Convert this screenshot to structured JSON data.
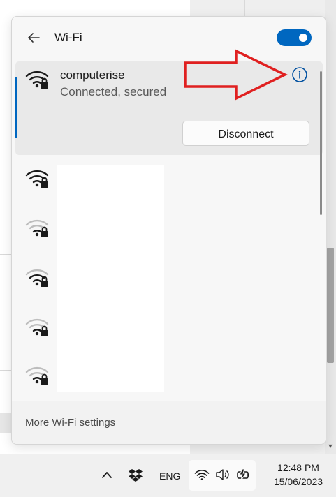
{
  "flyout": {
    "title": "Wi-Fi",
    "wifi_enabled": true,
    "accent_color": "#0067c0",
    "connected_network": {
      "ssid": "computerise",
      "status": "Connected, secured",
      "disconnect_label": "Disconnect",
      "icon": "wifi-secured-icon"
    },
    "other_networks": [
      {
        "icon": "wifi-secured-icon",
        "signal": "full"
      },
      {
        "icon": "wifi-secured-icon",
        "signal": "weak"
      },
      {
        "icon": "wifi-secured-icon",
        "signal": "medium"
      },
      {
        "icon": "wifi-secured-icon",
        "signal": "weak"
      },
      {
        "icon": "wifi-secured-icon",
        "signal": "weak"
      }
    ],
    "footer_link": "More Wi-Fi settings"
  },
  "annotation": {
    "color": "#e02020",
    "icon": "red-arrow"
  },
  "taskbar": {
    "language": "ENG",
    "time": "12:48 PM",
    "date": "15/06/2023",
    "icons": [
      "chevron-up-icon",
      "dropbox-icon",
      "wifi-icon",
      "speaker-icon",
      "battery-charging-icon"
    ]
  }
}
